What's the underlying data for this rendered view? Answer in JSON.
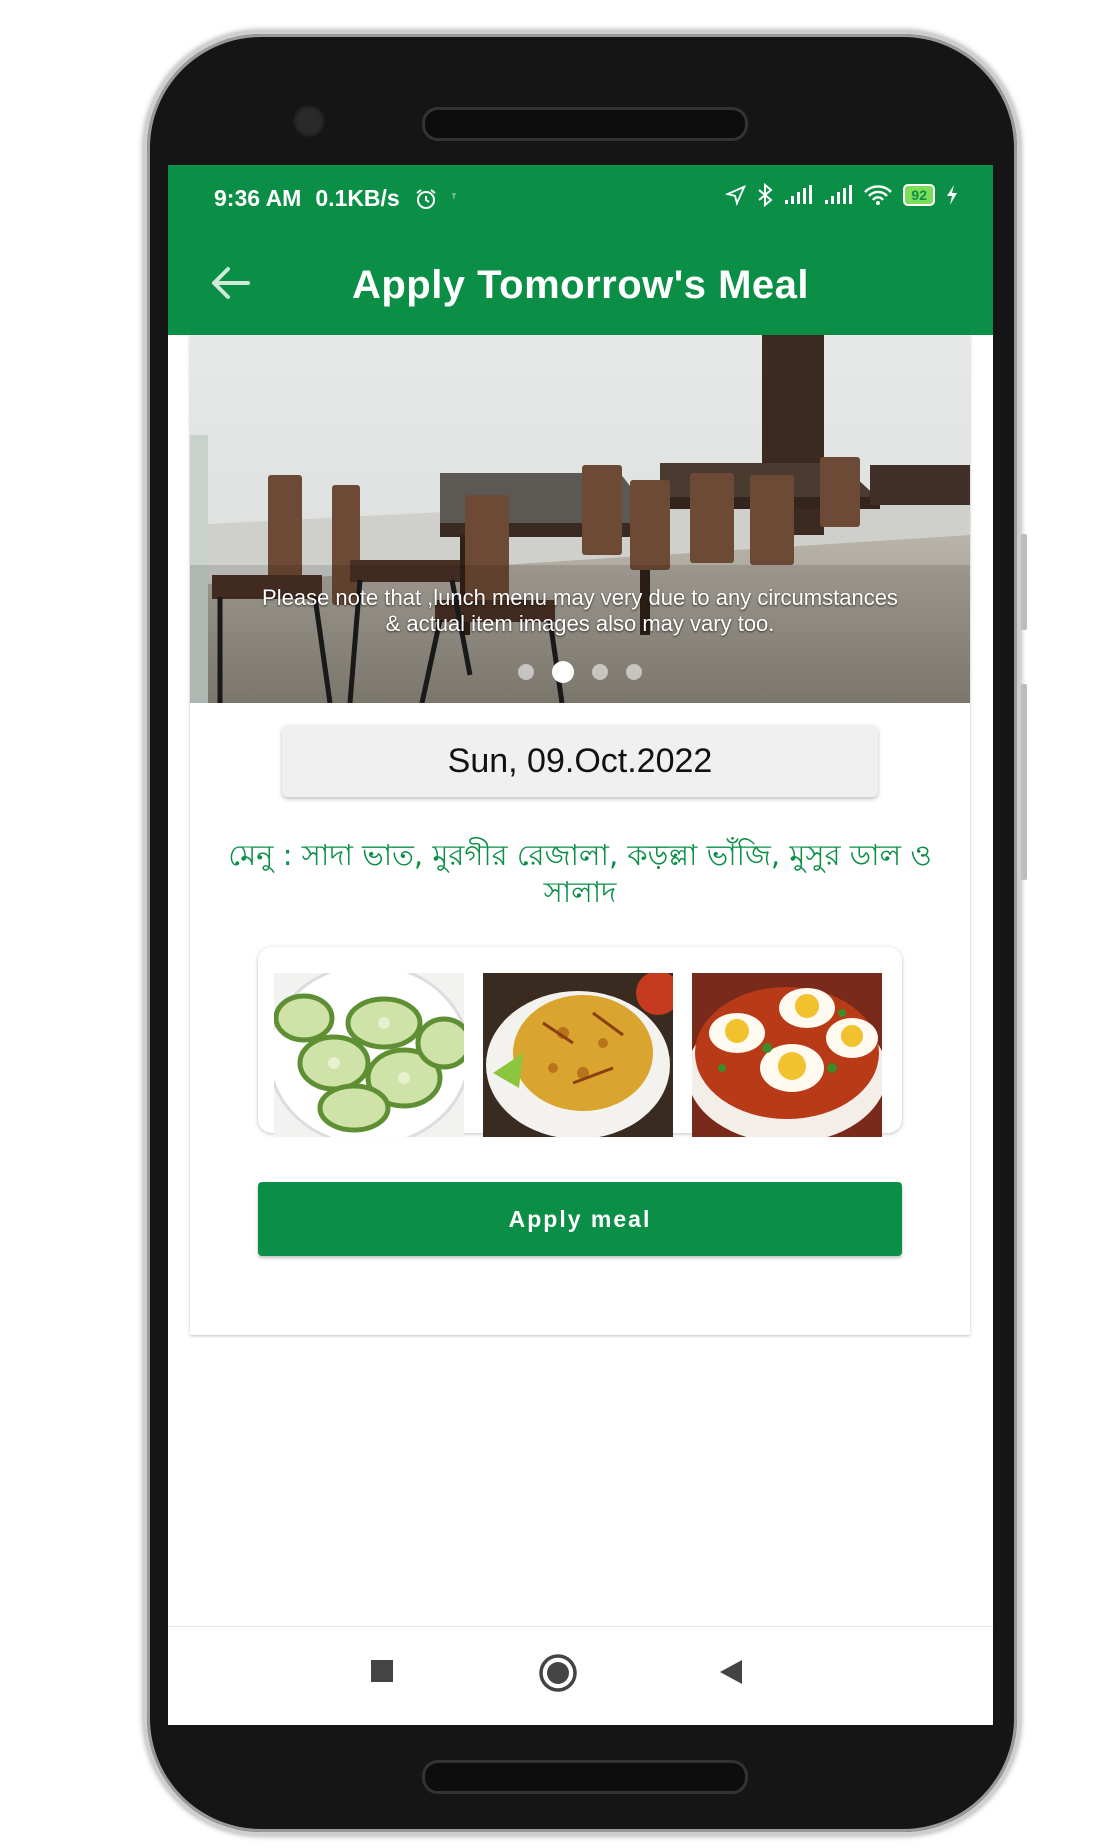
{
  "status_bar": {
    "time": "9:36 AM",
    "speed": "0.1KB/s",
    "battery": "92"
  },
  "app_bar": {
    "title": "Apply Tomorrow's Meal"
  },
  "banner": {
    "notice_line1": "Please note that ,lunch menu may very due to any circumstances",
    "notice_line2": "& actual item images also may vary too.",
    "slides": 4,
    "active_slide": 2
  },
  "date": "Sun, 09.Oct.2022",
  "menu_text": "মেনু : সাদা ভাত, মুরগীর রেজালা, কড়ল্লা ভাঁজি, মুসুর ডাল ও সালাদ",
  "food_images": [
    {
      "name": "cucumber-salad-image"
    },
    {
      "name": "pulao-rice-image"
    },
    {
      "name": "egg-curry-image"
    }
  ],
  "apply_button": "Apply meal",
  "colors": {
    "primary": "#0b8f47",
    "menu_text": "#0b8f47"
  },
  "nav": [
    "recents-icon",
    "home-icon",
    "back-icon"
  ]
}
